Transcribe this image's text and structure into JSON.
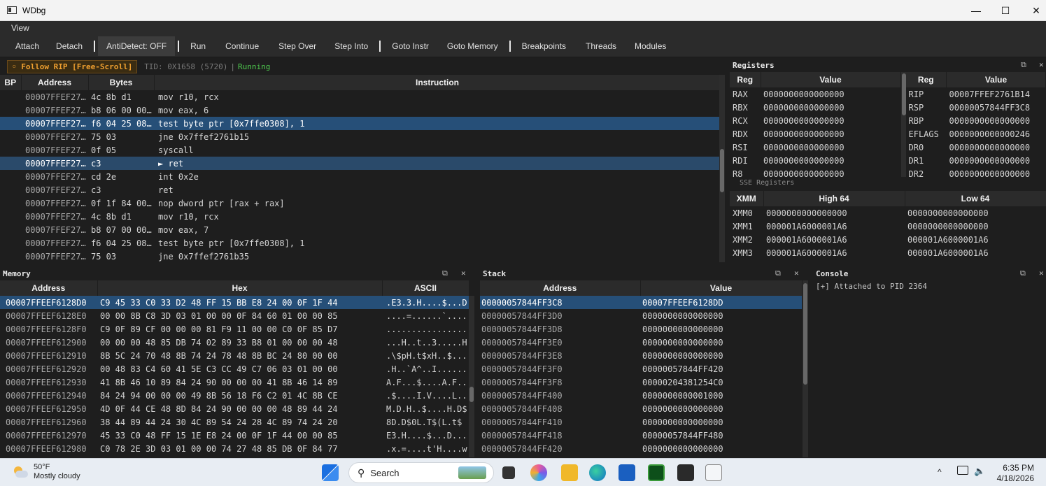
{
  "window": {
    "title": "WDbg",
    "minimize_glyph": "—",
    "maximize_glyph": "☐",
    "close_glyph": "✕"
  },
  "menu": {
    "items": [
      "View"
    ]
  },
  "toolbar": {
    "attach": "Attach",
    "detach": "Detach",
    "antidetect": "AntiDetect: OFF",
    "run": "Run",
    "continue": "Continue",
    "step_over": "Step Over",
    "step_into": "Step Into",
    "goto_instr": "Goto Instr",
    "goto_memory": "Goto Memory",
    "breakpoints": "Breakpoints",
    "threads": "Threads",
    "modules": "Modules"
  },
  "disasm": {
    "follow_label": "◦ Follow RIP  [Free-Scroll]",
    "tid": "TID: 0X1658 (5720)",
    "sep": "|",
    "state": "Running",
    "columns": [
      "BP",
      "Address",
      "Bytes",
      "Instruction"
    ],
    "rows": [
      {
        "addr": "00007FFEF276…",
        "bytes": "4c 8b d1",
        "instr": "mov r10, rcx"
      },
      {
        "addr": "00007FFEF276…",
        "bytes": "b8 06 00 00 …",
        "instr": "mov eax, 6"
      },
      {
        "addr": "00007FFEF276…",
        "bytes": "f6 04 25 08 …",
        "instr": "test byte ptr [0x7ffe0308], 1",
        "selected": true
      },
      {
        "addr": "00007FFEF276…",
        "bytes": "75 03",
        "instr": "jne 0x7ffef2761b15"
      },
      {
        "addr": "00007FFEF276…",
        "bytes": "0f 05",
        "instr": "syscall"
      },
      {
        "addr": "00007FFEF276…",
        "bytes": "c3",
        "instr": "► ret",
        "current": true
      },
      {
        "addr": "00007FFEF276…",
        "bytes": "cd 2e",
        "instr": "int 0x2e"
      },
      {
        "addr": "00007FFEF276…",
        "bytes": "c3",
        "instr": "ret"
      },
      {
        "addr": "00007FFEF276…",
        "bytes": "0f 1f 84 00 …",
        "instr": "nop dword ptr [rax + rax]"
      },
      {
        "addr": "00007FFEF276…",
        "bytes": "4c 8b d1",
        "instr": "mov r10, rcx"
      },
      {
        "addr": "00007FFEF276…",
        "bytes": "b8 07 00 00 …",
        "instr": "mov eax, 7"
      },
      {
        "addr": "00007FFEF276…",
        "bytes": "f6 04 25 08 …",
        "instr": "test byte ptr [0x7ffe0308], 1"
      },
      {
        "addr": "00007FFEF276…",
        "bytes": "75 03",
        "instr": "jne 0x7ffef2761b35"
      }
    ]
  },
  "registers": {
    "title": "Registers",
    "columns": [
      "Reg",
      "Value",
      "Reg",
      "Value"
    ],
    "left": [
      {
        "reg": "RAX",
        "val": "0000000000000000"
      },
      {
        "reg": "RBX",
        "val": "0000000000000000"
      },
      {
        "reg": "RCX",
        "val": "0000000000000000"
      },
      {
        "reg": "RDX",
        "val": "0000000000000000"
      },
      {
        "reg": "RSI",
        "val": "0000000000000000"
      },
      {
        "reg": "RDI",
        "val": "0000000000000000"
      },
      {
        "reg": "R8",
        "val": "0000000000000000"
      }
    ],
    "right": [
      {
        "reg": "RIP",
        "val": "00007FFEF2761B14"
      },
      {
        "reg": "RSP",
        "val": "00000057844FF3C8"
      },
      {
        "reg": "RBP",
        "val": "0000000000000000"
      },
      {
        "reg": "EFLAGS",
        "val": "0000000000000246"
      },
      {
        "reg": "DR0",
        "val": "0000000000000000"
      },
      {
        "reg": "DR1",
        "val": "0000000000000000"
      },
      {
        "reg": "DR2",
        "val": "0000000000000000"
      }
    ]
  },
  "sse": {
    "title": "SSE Registers",
    "columns": [
      "XMM",
      "High 64",
      "Low 64"
    ],
    "rows": [
      {
        "reg": "XMM0",
        "high": "0000000000000000",
        "low": "0000000000000000"
      },
      {
        "reg": "XMM1",
        "high": "000001A6000001A6",
        "low": "0000000000000000"
      },
      {
        "reg": "XMM2",
        "high": "000001A6000001A6",
        "low": "000001A6000001A6"
      },
      {
        "reg": "XMM3",
        "high": "000001A6000001A6",
        "low": "000001A6000001A6"
      }
    ]
  },
  "memory": {
    "title": "Memory",
    "columns": [
      "Address",
      "Hex",
      "ASCII"
    ],
    "rows": [
      {
        "addr": "00007FFEEF6128D0",
        "hex": "C9 45 33 C0 33 D2 48 FF 15 BB E8 24 00 0F 1F 44",
        "ascii": ".E3.3.H....$...D",
        "selected": true
      },
      {
        "addr": "00007FFEEF6128E0",
        "hex": "00 00 8B C8 3D 03 01 00 00 0F 84 60 01 00 00 85",
        "ascii": "....=......`...."
      },
      {
        "addr": "00007FFEEF6128F0",
        "hex": "C9 0F 89 CF 00 00 00 81 F9 11 00 00 C0 0F 85 D7",
        "ascii": "................"
      },
      {
        "addr": "00007FFEEF612900",
        "hex": "00 00 00 48 85 DB 74 02 89 33 B8 01 00 00 00 48",
        "ascii": "...H..t..3.....H"
      },
      {
        "addr": "00007FFEEF612910",
        "hex": "8B 5C 24 70 48 8B 74 24 78 48 8B BC 24 80 00 00",
        "ascii": ".\\$pH.t$xH..$..."
      },
      {
        "addr": "00007FFEEF612920",
        "hex": "00 48 83 C4 60 41 5E C3 CC 49 C7 06 03 01 00 00",
        "ascii": ".H..`A^..I......"
      },
      {
        "addr": "00007FFEEF612930",
        "hex": "41 8B 46 10 89 84 24 90 00 00 00 41 8B 46 14 89",
        "ascii": "A.F...$....A.F.."
      },
      {
        "addr": "00007FFEEF612940",
        "hex": "84 24 94 00 00 00 49 8B 56 18 F6 C2 01 4C 8B CE",
        "ascii": ".$....I.V....L.."
      },
      {
        "addr": "00007FFEEF612950",
        "hex": "4D 0F 44 CE 48 8D 84 24 90 00 00 00 48 89 44 24",
        "ascii": "M.D.H..$....H.D$"
      },
      {
        "addr": "00007FFEEF612960",
        "hex": "38 44 89 44 24 30 4C 89 54 24 28 4C 89 74 24 20",
        "ascii": "8D.D$0L.T$(L.t$ "
      },
      {
        "addr": "00007FFEEF612970",
        "hex": "45 33 C0 48 FF 15 1E E8 24 00 0F 1F 44 00 00 85",
        "ascii": "E3.H....$...D..."
      },
      {
        "addr": "00007FFEEF612980",
        "hex": "C0 78 2E 3D 03 01 00 00 74 27 48 85 DB 0F 84 77",
        "ascii": ".x.=....t'H....w"
      }
    ]
  },
  "stack": {
    "title": "Stack",
    "columns": [
      "Address",
      "Value"
    ],
    "rows": [
      {
        "addr": "00000057844FF3C8",
        "val": "00007FFEEF6128DD",
        "selected": true
      },
      {
        "addr": "00000057844FF3D0",
        "val": "0000000000000000"
      },
      {
        "addr": "00000057844FF3D8",
        "val": "0000000000000000"
      },
      {
        "addr": "00000057844FF3E0",
        "val": "0000000000000000"
      },
      {
        "addr": "00000057844FF3E8",
        "val": "0000000000000000"
      },
      {
        "addr": "00000057844FF3F0",
        "val": "00000057844FF420"
      },
      {
        "addr": "00000057844FF3F8",
        "val": "00000204381254C0"
      },
      {
        "addr": "00000057844FF400",
        "val": "0000000000001000"
      },
      {
        "addr": "00000057844FF408",
        "val": "0000000000000000"
      },
      {
        "addr": "00000057844FF410",
        "val": "0000000000000000"
      },
      {
        "addr": "00000057844FF418",
        "val": "00000057844FF480"
      },
      {
        "addr": "00000057844FF420",
        "val": "0000000000000000"
      }
    ]
  },
  "console": {
    "title": "Console",
    "lines": [
      "[+] Attached to PID 2364"
    ]
  },
  "panel_buttons": {
    "float": "⧉",
    "close": "✕"
  },
  "taskbar": {
    "weather_temp": "50°F",
    "weather_desc": "Mostly cloudy",
    "search_placeholder": "Search",
    "time": "6:35 PM",
    "date": "4/18/2026",
    "tray_chevron": "^"
  },
  "colors": {
    "selection": "#264f78",
    "follow_orange": "#f0a030",
    "running_green": "#4ec94e"
  }
}
